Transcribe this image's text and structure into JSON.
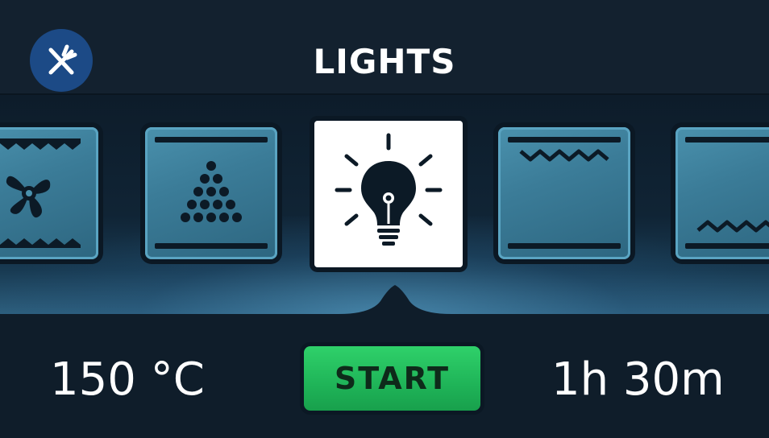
{
  "header": {
    "title": "LIGHTS",
    "logo_icon": "fork-knife-icon"
  },
  "carousel": {
    "items": [
      {
        "mode": "fan-heat",
        "icon": "fan-icon",
        "selected": false
      },
      {
        "mode": "dough-proof",
        "icon": "dots-triangle-icon",
        "selected": false
      },
      {
        "mode": "lights",
        "icon": "lightbulb-icon",
        "selected": true
      },
      {
        "mode": "top-heat",
        "icon": "top-heat-icon",
        "selected": false
      },
      {
        "mode": "bottom-heat",
        "icon": "bottom-heat-icon",
        "selected": false
      }
    ]
  },
  "footer": {
    "temperature": "150 °C",
    "start_label": "START",
    "duration": "1h 30m"
  },
  "colors": {
    "background": "#0f1d2a",
    "tile": "#3b7c98",
    "selected_tile": "#ffffff",
    "start_green": "#1fb458",
    "logo_blue": "#1c4a86"
  }
}
